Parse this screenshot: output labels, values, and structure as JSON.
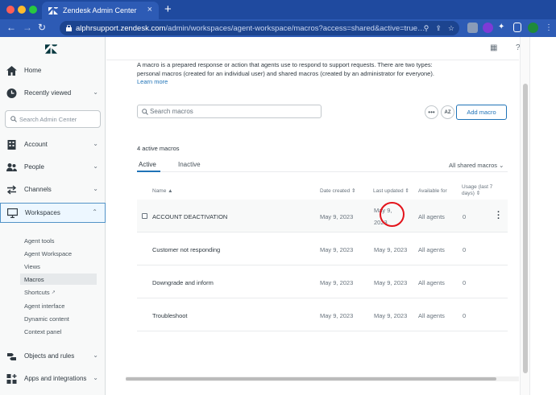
{
  "browser": {
    "tab_title": "Zendesk Admin Center",
    "url_host": "alphrsupport.zendesk.com",
    "url_path": "/admin/workspaces/agent-workspace/macros?access=shared&active=true…"
  },
  "sidebar": {
    "search_placeholder": "Search Admin Center",
    "items": [
      {
        "label": "Home"
      },
      {
        "label": "Recently viewed"
      },
      {
        "label": "Account"
      },
      {
        "label": "People"
      },
      {
        "label": "Channels"
      },
      {
        "label": "Workspaces"
      },
      {
        "label": "Objects and rules"
      },
      {
        "label": "Apps and integrations"
      }
    ],
    "workspaces_sub": [
      "Agent tools",
      "Agent Workspace",
      "Views",
      "Macros",
      "Shortcuts",
      "Agent interface",
      "Dynamic content",
      "Context panel"
    ]
  },
  "main": {
    "description": "A macro is a prepared response or action that agents use to respond to support requests. There are two types: personal macros (created for an individual user) and shared macros (created by an administrator for everyone).",
    "learn_more": "Learn more",
    "search_placeholder": "Search macros",
    "sort_label": "AZ",
    "add_button": "Add macro",
    "count": "4 active macros",
    "tab_active": "Active",
    "tab_inactive": "Inactive",
    "filter": "All shared macros",
    "columns": {
      "name": "Name",
      "date_created": "Date created",
      "last_updated": "Last updated",
      "available_for": "Available for",
      "usage": "Usage (last 7 days)"
    },
    "rows": [
      {
        "name": "ACCOUNT DEACTIVATION",
        "created": "May 9, 2023",
        "updated_1": "May 9,",
        "updated_2": "2023",
        "available": "All agents",
        "usage": "0"
      },
      {
        "name": "Customer not responding",
        "created": "May 9, 2023",
        "updated": "May 9, 2023",
        "available": "All agents",
        "usage": "0"
      },
      {
        "name": "Downgrade and inform",
        "created": "May 9, 2023",
        "updated": "May 9, 2023",
        "available": "All agents",
        "usage": "0"
      },
      {
        "name": "Troubleshoot",
        "created": "May 9, 2023",
        "updated": "May 9, 2023",
        "available": "All agents",
        "usage": "0"
      }
    ]
  }
}
